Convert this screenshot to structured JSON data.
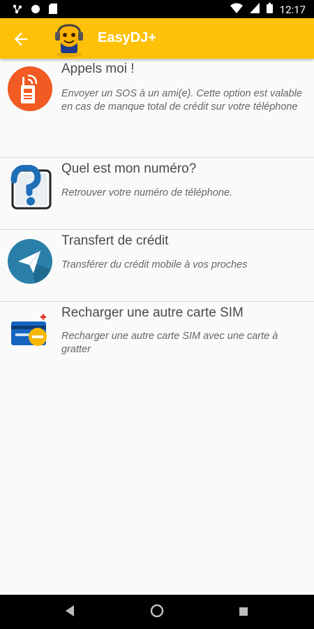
{
  "status_bar": {
    "time": "12:17",
    "icons": [
      "notification-icon",
      "circle-icon",
      "sd-card-icon",
      "wifi-icon",
      "signal-icon",
      "battery-icon"
    ]
  },
  "app_bar": {
    "title": "EasyDJ+",
    "back_icon": "arrow-back-icon",
    "background_color": "#ffc107"
  },
  "items": [
    {
      "title": "Appels moi !",
      "description": "Envoyer un SOS à un ami(e). Cette option est valable en cas de manque total de crédit sur votre téléphone",
      "icon": "phone-call-icon"
    },
    {
      "title": "Quel est mon numéro?",
      "description": "Retrouver votre numéro de téléphone.",
      "icon": "question-icon"
    },
    {
      "title": "Transfert de crédit",
      "description": "Transférer du crédit mobile à vos proches",
      "icon": "send-icon"
    },
    {
      "title": "Recharger une autre carte SIM",
      "description": "Recharger une autre carte SIM avec une carte à gratter",
      "icon": "card-recharge-icon"
    }
  ],
  "nav_bar": {
    "buttons": [
      "back-nav-icon",
      "home-nav-icon",
      "recents-nav-icon"
    ]
  }
}
